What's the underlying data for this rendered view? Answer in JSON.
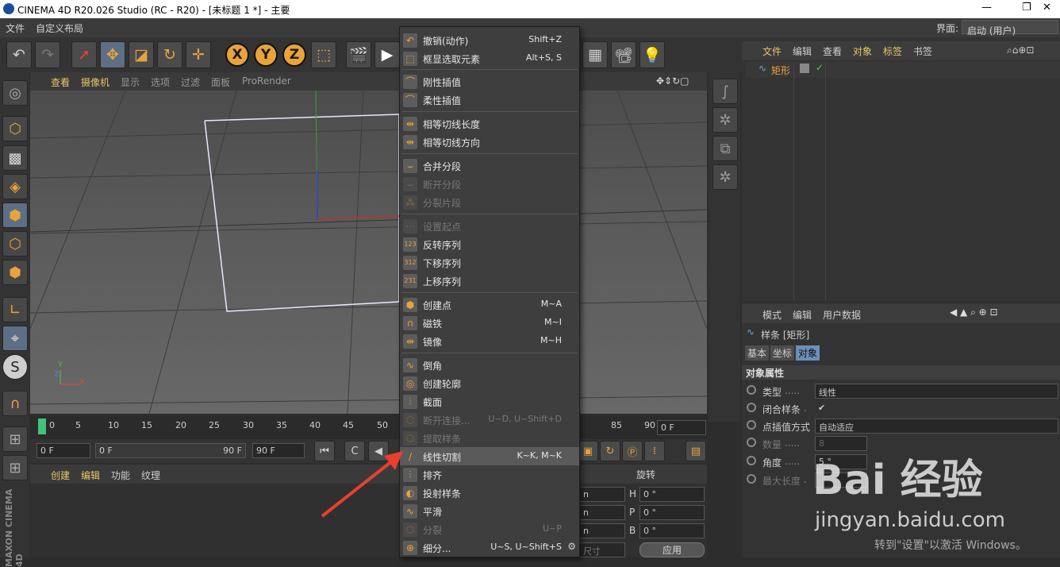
{
  "window": {
    "title": "CINEMA 4D R20.026 Studio (RC - R20) - [未标题 1 *] - 主要",
    "minimize": "—",
    "restore": "❐",
    "close": "✕"
  },
  "menubar": {
    "items": [
      "文件",
      "自定义布局"
    ],
    "layout_label": "界面:",
    "layout_value": "启动 (用户)"
  },
  "viewport": {
    "menu": [
      "查看",
      "摄像机",
      "显示",
      "选项",
      "过滤",
      "面板",
      "ProRender"
    ],
    "axis_x": "X",
    "axis_y": "Y",
    "axis_z": "Z"
  },
  "timeline": {
    "ticks": [
      "0",
      "5",
      "10",
      "15",
      "20",
      "25",
      "30",
      "35",
      "40",
      "45",
      "50",
      "85",
      "90"
    ],
    "frame": "0 F"
  },
  "transport": {
    "start": "0 F",
    "range_start": "0 F",
    "range_end": "90 F",
    "end": "90 F"
  },
  "material": {
    "menu": [
      "创建",
      "编辑",
      "功能",
      "纹理"
    ]
  },
  "coords": {
    "rot_header": "旋转",
    "rows": [
      {
        "axis": "H",
        "value": "0 °"
      },
      {
        "axis": "P",
        "value": "0 °"
      },
      {
        "axis": "B",
        "value": "0 °"
      }
    ],
    "size_label": "尺寸",
    "apply": "应用"
  },
  "objects": {
    "menu": [
      "文件",
      "编辑",
      "查看",
      "对象",
      "标签",
      "书签"
    ],
    "item": "矩形"
  },
  "attributes": {
    "menu": [
      "模式",
      "编辑",
      "用户数据"
    ],
    "title": "样条 [矩形]",
    "tabs": [
      "基本",
      "坐标",
      "对象"
    ],
    "section": "对象属性",
    "props": [
      {
        "label": "类型",
        "dots": " .....",
        "value": "线性"
      },
      {
        "label": "闭合样条",
        "dots": " .",
        "value": "✔"
      },
      {
        "label": "点插值方式",
        "dots": "",
        "value": "自动适应"
      },
      {
        "label": "数量",
        "dots": " .....",
        "value": "8"
      },
      {
        "label": "角度",
        "dots": " .....",
        "value": "5 °"
      },
      {
        "label": "最大长度",
        "dots": " .",
        "value": ""
      }
    ]
  },
  "context_menu": {
    "items": [
      {
        "label": "撤销(动作)",
        "shortcut": "Shift+Z"
      },
      {
        "label": "框显选取元素",
        "shortcut": "Alt+S, S"
      },
      {
        "label": "刚性插值",
        "shortcut": ""
      },
      {
        "label": "柔性插值",
        "shortcut": ""
      },
      {
        "label": "相等切线长度",
        "shortcut": ""
      },
      {
        "label": "相等切线方向",
        "shortcut": ""
      },
      {
        "label": "合并分段",
        "shortcut": ""
      },
      {
        "label": "断开分段",
        "shortcut": ""
      },
      {
        "label": "分裂片段",
        "shortcut": ""
      },
      {
        "label": "设置起点",
        "shortcut": ""
      },
      {
        "label": "反转序列",
        "shortcut": ""
      },
      {
        "label": "下移序列",
        "shortcut": ""
      },
      {
        "label": "上移序列",
        "shortcut": ""
      },
      {
        "label": "创建点",
        "shortcut": "M~A"
      },
      {
        "label": "磁铁",
        "shortcut": "M~I"
      },
      {
        "label": "镜像",
        "shortcut": "M~H"
      },
      {
        "label": "倒角",
        "shortcut": ""
      },
      {
        "label": "创建轮廓",
        "shortcut": ""
      },
      {
        "label": "截面",
        "shortcut": ""
      },
      {
        "label": "断开连接...",
        "shortcut": "U~D, U~Shift+D"
      },
      {
        "label": "提取样条",
        "shortcut": ""
      },
      {
        "label": "线性切割",
        "shortcut": "K~K, M~K"
      },
      {
        "label": "排齐",
        "shortcut": ""
      },
      {
        "label": "投射样条",
        "shortcut": ""
      },
      {
        "label": "平滑",
        "shortcut": ""
      },
      {
        "label": "分裂",
        "shortcut": "U~P"
      },
      {
        "label": "细分...",
        "shortcut": "U~S, U~Shift+S"
      }
    ]
  },
  "watermark": {
    "brand": "Bai 经验",
    "url": "jingyan.baidu.com",
    "activate": "转到\"设置\"以激活 Windows。"
  },
  "side_brand": "MAXON CINEMA 4D",
  "colors": {
    "accent": "#e8a33b",
    "highlight": "#5a5a5a",
    "menu_bg": "#3e3e3e",
    "arrow": "#e8402f"
  }
}
